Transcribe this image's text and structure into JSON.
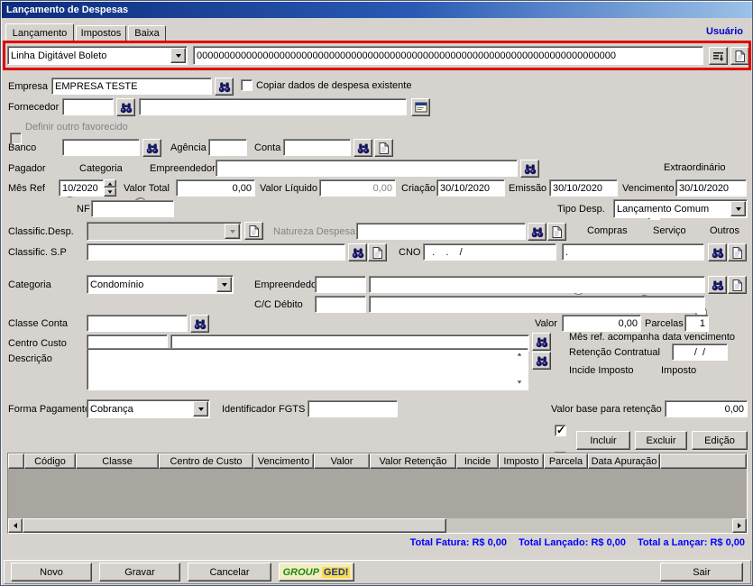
{
  "window": {
    "title": "Lançamento de Despesas"
  },
  "header": {
    "user": "Usuário"
  },
  "tabs": {
    "items": [
      {
        "label": "Lançamento"
      },
      {
        "label": "Impostos"
      },
      {
        "label": "Baixa"
      }
    ]
  },
  "boleto": {
    "type": "Linha Digitável Boleto",
    "number": "0000000000000000000000000000000000000000000000000000000000000000000000000000"
  },
  "empresa": {
    "label": "Empresa",
    "value": "EMPRESA TESTE",
    "copy_label": "Copiar dados de despesa existente"
  },
  "fornecedor": {
    "label": "Fornecedor",
    "code": "",
    "name": ""
  },
  "favorecido": {
    "label": "Definir outro favorecido"
  },
  "banco": {
    "label": "Banco",
    "value": ""
  },
  "agencia": {
    "label": "Agência",
    "value": ""
  },
  "conta": {
    "label": "Conta",
    "value": ""
  },
  "pagador": {
    "label": "Pagador",
    "option_categoria": "Categoria",
    "option_empreendedor": "Empreendedor",
    "value": ""
  },
  "extraordinario": {
    "label": "Extraordinário"
  },
  "mes_ref": {
    "label": "Mês Ref",
    "value": "10/2020"
  },
  "valor_total": {
    "label": "Valor Total",
    "value": "0,00"
  },
  "valor_liquido": {
    "label": "Valor Líquido",
    "value": "0,00"
  },
  "criacao": {
    "label": "Criação",
    "value": "30/10/2020"
  },
  "emissao": {
    "label": "Emissão",
    "value": "30/10/2020"
  },
  "vencimento": {
    "label": "Vencimento",
    "value": "30/10/2020"
  },
  "nf": {
    "label": "NF",
    "value": ""
  },
  "tipo_desp": {
    "label": "Tipo Desp.",
    "value": "Lançamento Comum"
  },
  "classific_desp": {
    "label": "Classific.Desp.",
    "value": ""
  },
  "natureza": {
    "label": "Natureza Despesa",
    "value": ""
  },
  "tipo_despesa_opcoes": {
    "compras": "Compras",
    "servico": "Serviço",
    "outros": "Outros"
  },
  "classific_sp": {
    "label": "Classific. S.P",
    "value": ""
  },
  "cno": {
    "label": "CNO",
    "value": "  .    .    /",
    "value2": "."
  },
  "categoria": {
    "label": "Categoria",
    "value": "Condomínio"
  },
  "empreendedor": {
    "label": "Empreendedor",
    "code": "",
    "name": ""
  },
  "cc_debito": {
    "label": "C/C Débito",
    "code": "",
    "name": ""
  },
  "classe_conta": {
    "label": "Classe Conta",
    "value": ""
  },
  "valor": {
    "label": "Valor",
    "value": "0,00"
  },
  "parcelas": {
    "label": "Parcelas",
    "value": "1"
  },
  "centro_custo": {
    "label": "Centro Custo",
    "code": "",
    "name": ""
  },
  "opcoes": {
    "mes_ref_acompanha": "Mês ref. acompanha data vencimento",
    "retencao_contratual": "Retenção Contratual",
    "retencao_data": "/  /",
    "incide_imposto": "Incide Imposto",
    "imposto": "Imposto"
  },
  "descricao": {
    "label": "Descrição",
    "value": ""
  },
  "forma_pagamento": {
    "label": "Forma Pagamento",
    "value": "Cobrança"
  },
  "fgts": {
    "label": "Identificador FGTS",
    "value": ""
  },
  "valor_base": {
    "label": "Valor base para retenção",
    "value": "0,00"
  },
  "actions": {
    "incluir": "Incluir",
    "excluir": "Excluir",
    "edicao": "Edição"
  },
  "grid": {
    "headers": [
      "",
      "Código",
      "Classe",
      "Centro de Custo",
      "Vencimento",
      "Valor",
      "Valor Retenção",
      "Incide",
      "Imposto",
      "Parcela",
      "Data Apuração"
    ]
  },
  "totals": {
    "fatura": "Total Fatura: R$ 0,00",
    "lancado": "Total Lançado: R$ 0,00",
    "a_lancar": "Total a Lançar: R$ 0,00"
  },
  "footer": {
    "novo": "Novo",
    "gravar": "Gravar",
    "cancelar": "Cancelar",
    "logo_group": "GROUP",
    "logo_ged": "GED!",
    "sair": "Sair"
  }
}
